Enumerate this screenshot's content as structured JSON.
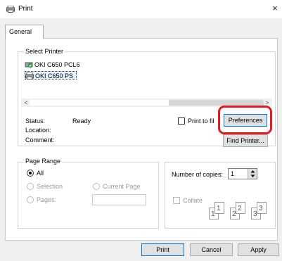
{
  "window": {
    "title": "Print",
    "close_glyph": "×"
  },
  "tabs": [
    {
      "label": "General"
    }
  ],
  "select_printer": {
    "group_label": "Select Printer",
    "printers": [
      {
        "name": "OKI C650 PCL6",
        "icon": "printer-default-icon",
        "selected": false
      },
      {
        "name": "OKI C650 PS",
        "icon": "printer-icon",
        "selected": true
      }
    ],
    "scroll_left": "<",
    "scroll_right": ">"
  },
  "status": {
    "status_label": "Status:",
    "status_value": "Ready",
    "location_label": "Location:",
    "comment_label": "Comment:"
  },
  "print_to_file": {
    "label": "Print to file"
  },
  "buttons": {
    "preferences": "Preferences",
    "find_printer": "Find Printer...",
    "print": "Print",
    "cancel": "Cancel",
    "apply": "Apply"
  },
  "page_range": {
    "group_label": "Page Range",
    "all": "All",
    "selection": "Selection",
    "current_page": "Current Page",
    "pages": "Pages:",
    "pages_value": ""
  },
  "copies": {
    "label": "Number of copies:",
    "value": "1",
    "collate_label": "Collate",
    "collate_pages": [
      "1",
      "1",
      "2",
      "2",
      "3",
      "3"
    ]
  },
  "colors": {
    "highlight": "#e11b22",
    "selection_bg": "#e5f1fb",
    "dialog_bg": "#f0f0f0"
  }
}
